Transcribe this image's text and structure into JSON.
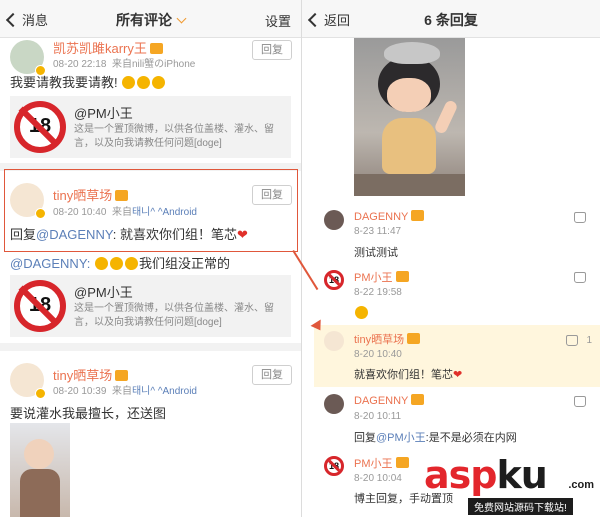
{
  "left": {
    "nav": {
      "back": "消息",
      "title": "所有评论",
      "right": "设置"
    },
    "comments": [
      {
        "user": "凯苏凯雎karry王",
        "time": "08-20 22:18",
        "source_prefix": "来自",
        "source": "nili蟹のiPhone",
        "reply_label": "回复",
        "text": "我要请教我要请教!",
        "quote": {
          "title": "@PM小王",
          "desc": "这是一个置顶微博，以供各位盖楼、灌水、留言，以及向我请教任何问题[doge]",
          "badge": "18"
        }
      },
      {
        "user": "tiny晒草场",
        "time": "08-20 10:40",
        "source_prefix": "来自",
        "source": "태니^ ^Android",
        "reply_label": "回复",
        "text_prefix": "回复",
        "mention": "@DAGENNY",
        "text_rest": ": 就喜欢你们组！笔芯",
        "heart": "❤",
        "forward_mention": "@DAGENNY:",
        "forward_rest": "我们组没正常的",
        "quote": {
          "title": "@PM小王",
          "desc": "这是一个置顶微博，以供各位盖楼、灌水、留言，以及向我请教任何问题[doge]",
          "badge": "18"
        }
      },
      {
        "user": "tiny晒草场",
        "time": "08-20 10:39",
        "source_prefix": "来自",
        "source": "태니^ ^Android",
        "reply_label": "回复",
        "text": "要说灌水我最擅长，还送图"
      }
    ]
  },
  "right": {
    "nav": {
      "back": "返回",
      "title": "6 条回复"
    },
    "replies": [
      {
        "user": "DAGENNY",
        "time": "8-23 11:47",
        "text": "测试测试"
      },
      {
        "user": "PM小王",
        "time": "8-22 19:58",
        "text": "",
        "badge": "18"
      },
      {
        "user": "tiny晒草场",
        "time": "8-20 10:40",
        "text": "就喜欢你们组！笔芯",
        "heart": "❤",
        "likes": "1"
      },
      {
        "user": "DAGENNY",
        "time": "8-20 10:11",
        "text_prefix": "回复",
        "mention": "@PM小王",
        "text_rest": ":是不是必须在内网"
      },
      {
        "user": "PM小王",
        "time": "8-20 10:04",
        "text": "博主回复，手动置顶",
        "badge": "18"
      }
    ]
  },
  "watermark": {
    "asp": "asp",
    "ku": "ku",
    "com": ".com",
    "sub": "免费网站源码下载站!"
  },
  "colors": {
    "accent": "#eb7350",
    "link": "#5b7fb8",
    "highlight": "#fff6dd",
    "annotation": "#e0573b",
    "ban_red": "#d7262b"
  }
}
